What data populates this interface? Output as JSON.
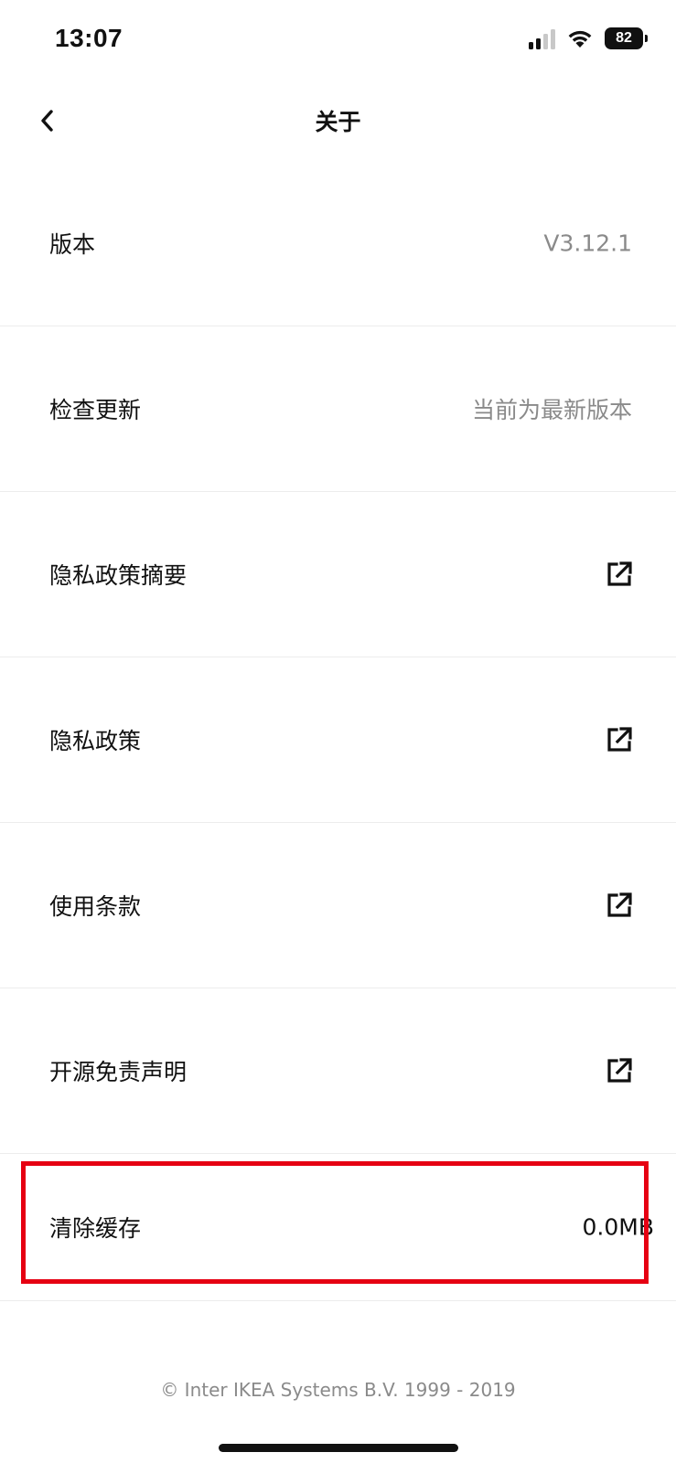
{
  "status_bar": {
    "time": "13:07",
    "battery": "82"
  },
  "header": {
    "title": "关于",
    "back_icon": "chevron-left-icon"
  },
  "rows": [
    {
      "label": "版本",
      "value": "V3.12.1"
    },
    {
      "label": "检查更新",
      "value": "当前为最新版本"
    },
    {
      "label": "隐私政策摘要",
      "icon": "external-link-icon"
    },
    {
      "label": "隐私政策",
      "icon": "external-link-icon"
    },
    {
      "label": "使用条款",
      "icon": "external-link-icon"
    },
    {
      "label": "开源免责声明",
      "icon": "external-link-icon"
    },
    {
      "label": "清除缓存",
      "value": "0.0MB"
    }
  ],
  "footer": {
    "copyright": "© Inter IKEA Systems B.V. 1999 - 2019"
  },
  "colors": {
    "highlight": "#e60012",
    "secondary_text": "#8a8a8a",
    "divider": "#ececec"
  }
}
